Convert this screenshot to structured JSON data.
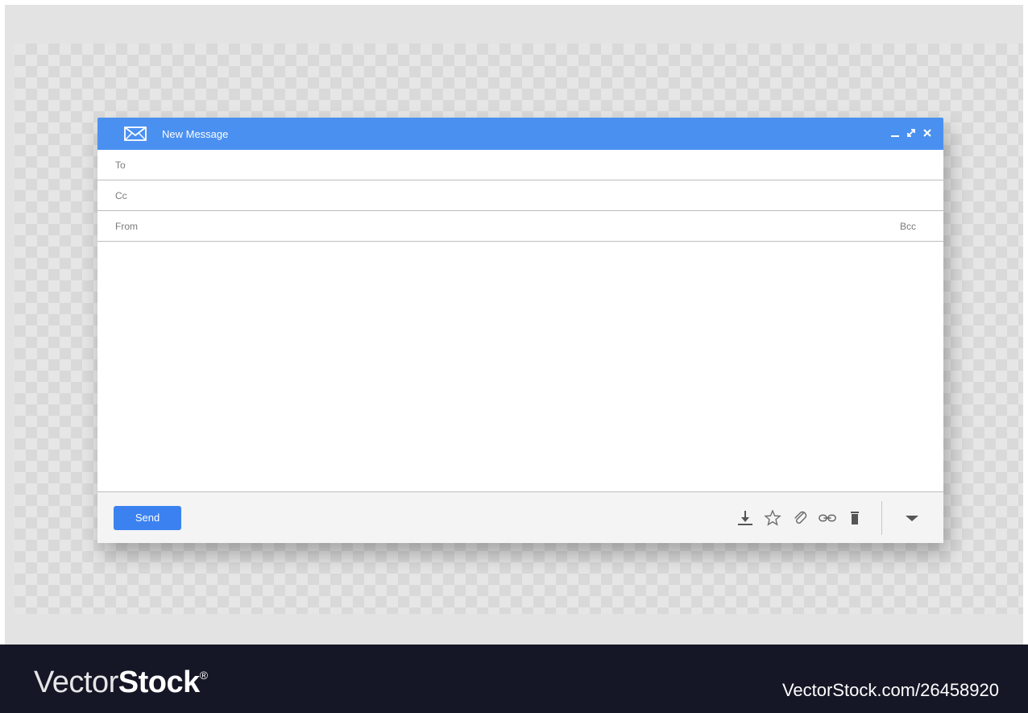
{
  "window": {
    "title": "New Message",
    "controls": [
      "minimize-icon",
      "expand-icon",
      "close-icon"
    ]
  },
  "fields": {
    "to_label": "To",
    "cc_label": "Cc",
    "from_label": "From",
    "bcc_label": "Bcc"
  },
  "footer": {
    "send_label": "Send",
    "tools": [
      "download-icon",
      "star-icon",
      "paperclip-icon",
      "link-icon",
      "trash-icon",
      "dropdown-arrow-icon"
    ]
  },
  "colors": {
    "accent": "#4a90f0",
    "send_button": "#3b82f0",
    "watermark_bg": "#151726"
  },
  "watermark": {
    "brand_light": "Vector",
    "brand_bold": "Stock",
    "brand_mark": "®",
    "url": "VectorStock.com/26458920"
  }
}
